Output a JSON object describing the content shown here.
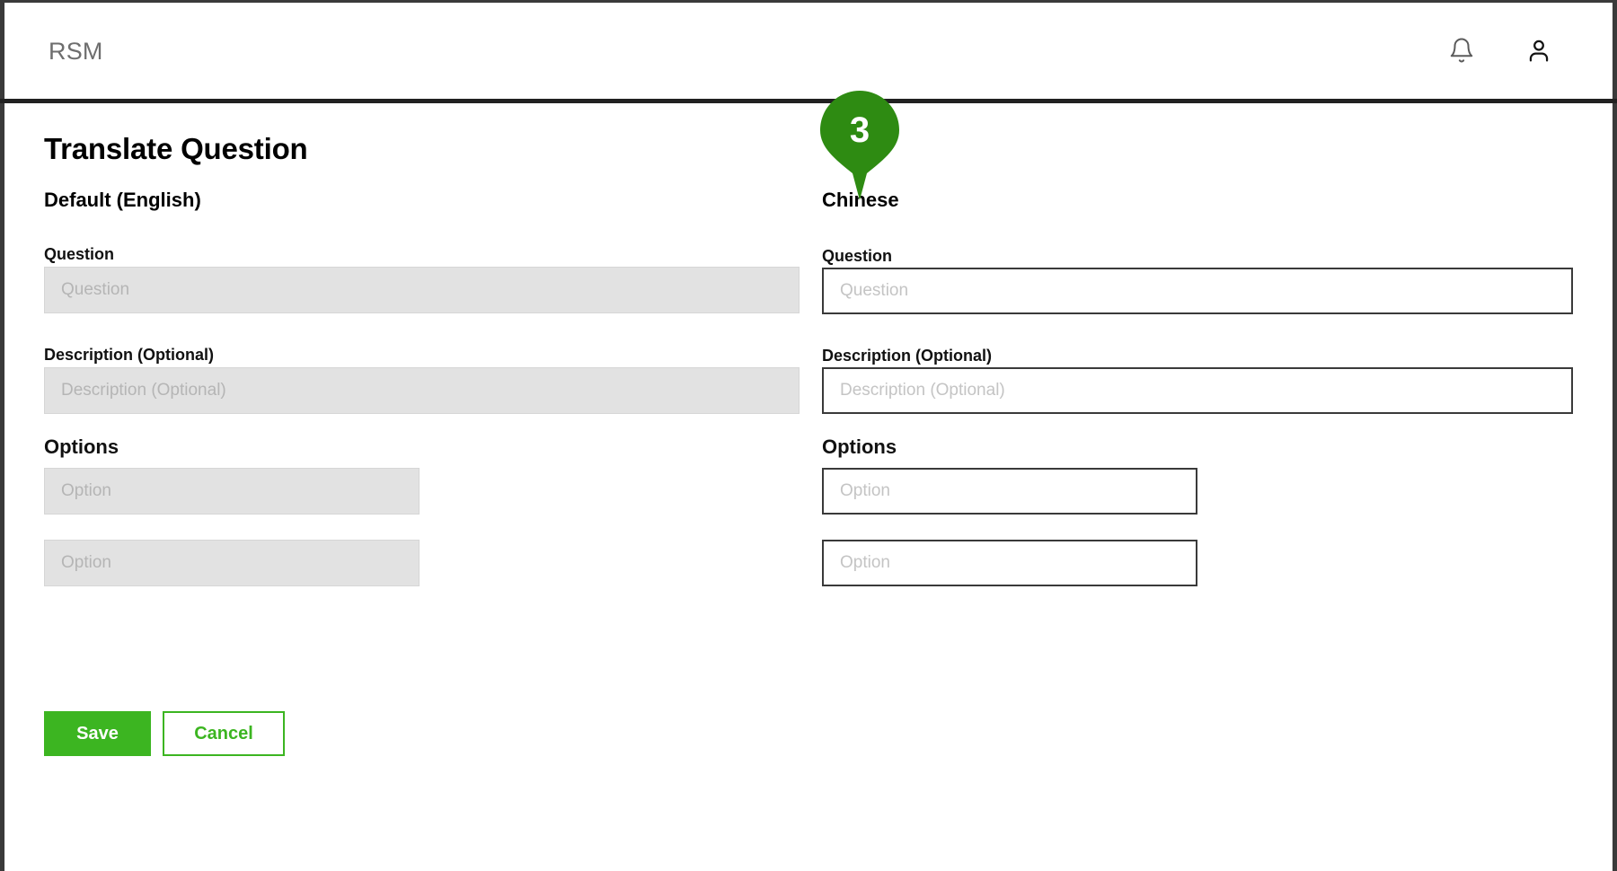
{
  "app": {
    "brand": "RSM",
    "accent_green": "#3cb521",
    "marker_green": "#2e8b12",
    "header_rule_color": "#212121"
  },
  "topbar": {
    "notifications_icon": "bell-icon",
    "account_icon": "person-icon"
  },
  "step_marker": {
    "number": "3"
  },
  "page": {
    "title": "Translate Question"
  },
  "columns": {
    "left": {
      "heading": "Default (English)",
      "fields": {
        "question": {
          "label": "Question",
          "placeholder": "Question",
          "value": "",
          "disabled": true
        },
        "description": {
          "label": "Description (Optional)",
          "placeholder": "Description (Optional)",
          "value": "",
          "disabled": true
        },
        "options": {
          "label": "Options",
          "items": [
            {
              "placeholder": "Option",
              "value": "",
              "disabled": true
            },
            {
              "placeholder": "Option",
              "value": "",
              "disabled": true
            }
          ]
        }
      }
    },
    "right": {
      "heading": "Chinese",
      "fields": {
        "question": {
          "label": "Question",
          "placeholder": "Question",
          "value": "",
          "disabled": false
        },
        "description": {
          "label": "Description (Optional)",
          "placeholder": "Description (Optional)",
          "value": "",
          "disabled": false
        },
        "options": {
          "label": "Options",
          "items": [
            {
              "placeholder": "Option",
              "value": "",
              "disabled": false
            },
            {
              "placeholder": "Option",
              "value": "",
              "disabled": false
            }
          ]
        }
      }
    }
  },
  "actions": {
    "save_label": "Save",
    "cancel_label": "Cancel"
  }
}
